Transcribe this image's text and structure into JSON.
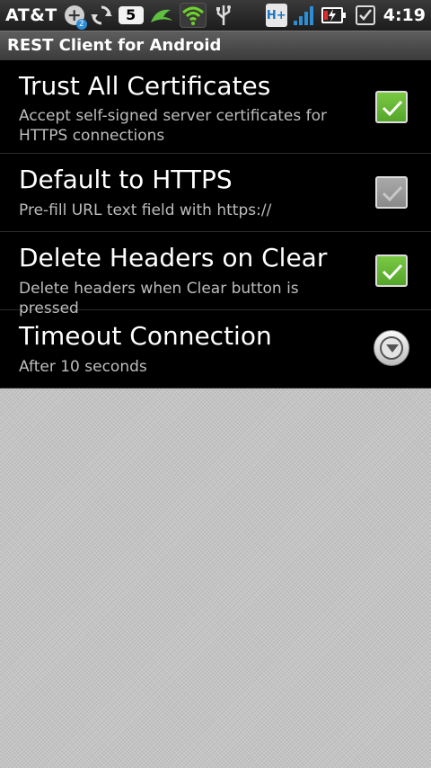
{
  "status_bar": {
    "carrier": "AT&T",
    "notification_badge": "2",
    "notification_count": "5",
    "time": "4:19",
    "network_type": "H+"
  },
  "app": {
    "title": "REST Client for Android"
  },
  "preferences": [
    {
      "title": "Trust All Certificates",
      "summary": "Accept self-signed server certificates for HTTPS connections",
      "control": "checkbox",
      "checked": true
    },
    {
      "title": "Default to HTTPS",
      "summary": "Pre-fill URL text field with https://",
      "control": "checkbox",
      "checked": false
    },
    {
      "title": "Delete Headers on Clear",
      "summary": "Delete headers when Clear button is pressed",
      "control": "checkbox",
      "checked": true
    },
    {
      "title": "Timeout Connection",
      "summary": "After 10 seconds",
      "control": "dropdown"
    }
  ],
  "icons": {
    "status": [
      "add-icon",
      "sync-icon",
      "count-icon",
      "dolphin-icon",
      "wifi-icon",
      "usb-icon",
      "hplus-network-icon",
      "signal-icon",
      "battery-charging-icon",
      "checklist-icon"
    ],
    "dropdown": "chevron-down-icon",
    "checkbox": "check-icon"
  },
  "colors": {
    "checkbox_checked": "#66b832",
    "checkbox_unchecked": "#9a9a9a",
    "list_background": "#000000",
    "page_background": "#c4c4c4"
  }
}
